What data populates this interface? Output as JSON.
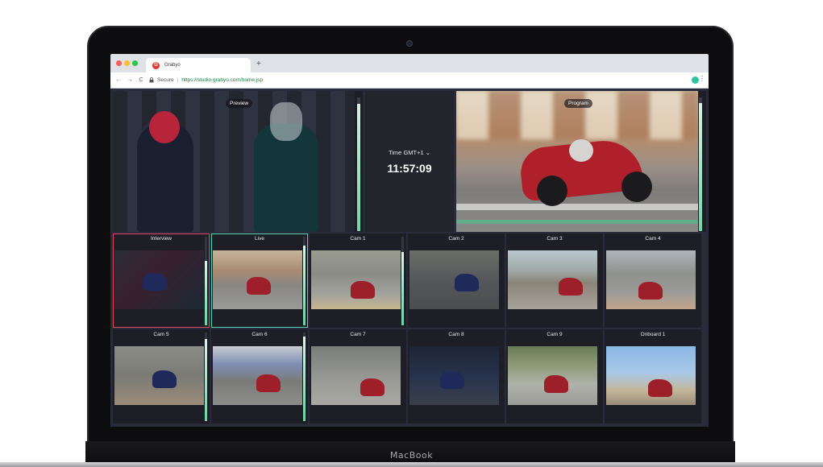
{
  "device": {
    "label": "MacBook"
  },
  "browser": {
    "tab_title": "Grabyo",
    "favicon_letter": "G",
    "new_tab": "+",
    "back": "←",
    "forward": "→",
    "reload": "C",
    "secure_label": "Secure",
    "separator": "|",
    "url": "https://studio.grabyo.com/home.jsp",
    "menu": "⋮"
  },
  "studio": {
    "preview_label": "Preview",
    "program_label": "Program",
    "timezone_label": "Time",
    "timezone_value": "GMT+1",
    "timezone_chevron": "⌄",
    "clock": "11:57:09",
    "preview_level": 0.95,
    "program_level": 0.96
  },
  "sources": [
    {
      "label": "Interview",
      "level": 0.73,
      "state": "preview"
    },
    {
      "label": "Live",
      "level": 0.9,
      "state": "program"
    },
    {
      "label": "Cam 1",
      "level": 0.83,
      "state": ""
    },
    {
      "label": "Cam 2",
      "level": 0,
      "state": ""
    },
    {
      "label": "Cam 3",
      "level": 0,
      "state": ""
    },
    {
      "label": "Cam 4",
      "level": 0,
      "state": ""
    },
    {
      "label": "Cam 5",
      "level": 0.93,
      "state": ""
    },
    {
      "label": "Cam 6",
      "level": 0.95,
      "state": ""
    },
    {
      "label": "Cam 7",
      "level": 0,
      "state": ""
    },
    {
      "label": "Cam 8",
      "level": 0,
      "state": ""
    },
    {
      "label": "Cam 9",
      "level": 0,
      "state": ""
    },
    {
      "label": "Onboard 1",
      "level": 0,
      "state": ""
    }
  ],
  "colors": {
    "preview_border": "#e0435e",
    "program_border": "#4fd1b2",
    "vu_meter": "#6fd6a8"
  }
}
